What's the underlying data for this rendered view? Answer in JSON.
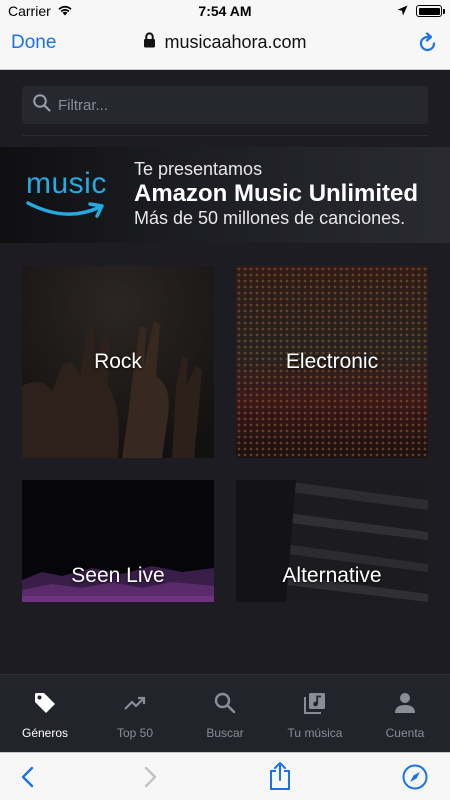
{
  "status_bar": {
    "carrier": "Carrier",
    "time": "7:54 AM"
  },
  "browser": {
    "done_label": "Done",
    "url": "musicaahora.com"
  },
  "search": {
    "placeholder": "Filtrar..."
  },
  "banner": {
    "logo_text": "music",
    "line1": "Te presentamos",
    "line2": "Amazon Music Unlimited",
    "line3": "Más de 50 millones de canciones."
  },
  "genres": [
    {
      "label": "Rock"
    },
    {
      "label": "Electronic"
    },
    {
      "label": "Seen Live"
    },
    {
      "label": "Alternative"
    }
  ],
  "tab_bar": {
    "tabs": [
      {
        "label": "Géneros",
        "icon": "tag-icon",
        "active": true
      },
      {
        "label": "Top 50",
        "icon": "trending-icon",
        "active": false
      },
      {
        "label": "Buscar",
        "icon": "search-icon",
        "active": false
      },
      {
        "label": "Tu música",
        "icon": "library-music-icon",
        "active": false
      },
      {
        "label": "Cuenta",
        "icon": "account-icon",
        "active": false
      }
    ]
  },
  "colors": {
    "accent": "#1a73e8",
    "background": "#1c1c22",
    "amazon_music_blue": "#25a9e0"
  }
}
